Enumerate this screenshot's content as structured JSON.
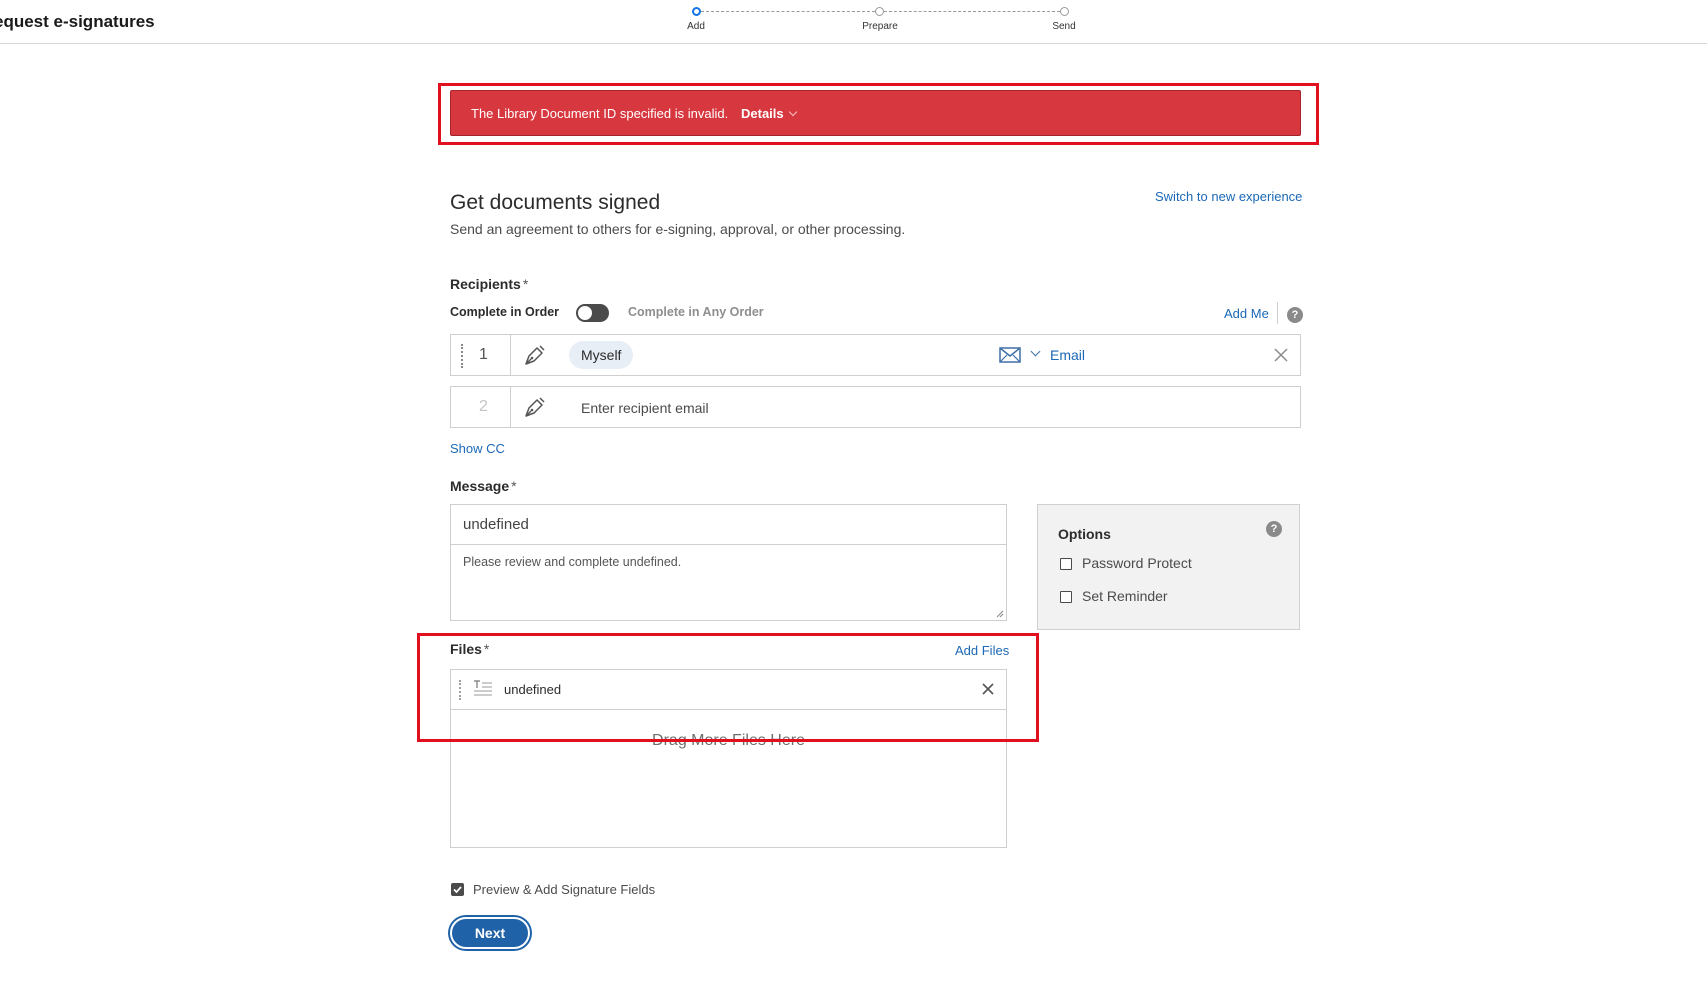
{
  "header": {
    "app_title": "equest e-signatures",
    "steps": [
      {
        "label": "Add",
        "active": true
      },
      {
        "label": "Prepare",
        "active": false
      },
      {
        "label": "Send",
        "active": false
      }
    ]
  },
  "error_banner": {
    "message": "The Library Document ID specified is invalid.",
    "details_label": "Details",
    "color": "#d7373f"
  },
  "page": {
    "title": "Get documents signed",
    "subtitle": "Send an agreement to others for e-signing, approval, or other processing.",
    "switch_link": "Switch to new experience"
  },
  "recipients": {
    "label": "Recipients",
    "required_mark": "*",
    "order_on_label": "Complete in Order",
    "order_off_label": "Complete in Any Order",
    "add_me_label": "Add Me",
    "help_icon": "?",
    "rows": [
      {
        "number": "1",
        "role_icon": "pen-icon",
        "recipient": "Myself",
        "auth_icon": "mail-icon",
        "auth_method": "Email"
      },
      {
        "number": "2",
        "role_icon": "pen-icon",
        "placeholder": "Enter recipient email"
      }
    ],
    "show_cc_label": "Show CC"
  },
  "message": {
    "label": "Message",
    "required_mark": "*",
    "subject": "undefined",
    "body": "Please review and complete undefined."
  },
  "options": {
    "title": "Options",
    "help_icon": "?",
    "items": [
      {
        "label": "Password Protect",
        "checked": false
      },
      {
        "label": "Set Reminder",
        "checked": false
      }
    ]
  },
  "files": {
    "label": "Files",
    "required_mark": "*",
    "add_files_label": "Add Files",
    "items": [
      {
        "name": "undefined",
        "icon": "document-icon"
      }
    ],
    "drop_text": "Drag More Files Here"
  },
  "footer": {
    "preview_label": "Preview & Add Signature Fields",
    "preview_checked": true,
    "next_label": "Next"
  },
  "colors": {
    "accent": "#1b68b6",
    "button": "#1f62a8",
    "annotation": "#e0101e"
  }
}
